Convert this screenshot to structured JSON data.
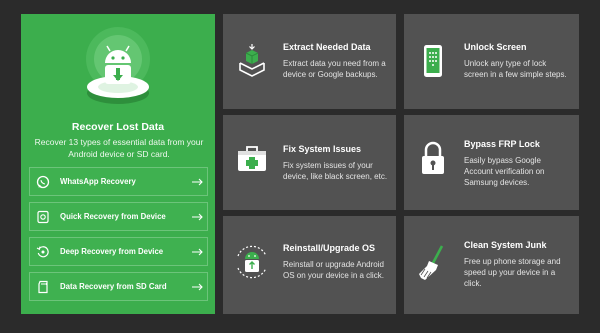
{
  "left": {
    "title": "Recover Lost Data",
    "desc": "Recover 13 types of essential data from your Android device or SD card.",
    "options": [
      {
        "label": "WhatsApp Recovery",
        "icon": "whatsapp-icon"
      },
      {
        "label": "Quick Recovery from Device",
        "icon": "phone-recovery-icon"
      },
      {
        "label": "Deep Recovery from Device",
        "icon": "deep-scan-icon"
      },
      {
        "label": "Data Recovery from SD Card",
        "icon": "sd-card-icon"
      }
    ]
  },
  "cards": {
    "extract": {
      "title": "Extract Needed Data",
      "desc": "Extract data you need from a device or Google backups.",
      "icon": "extract-box-icon"
    },
    "unlock": {
      "title": "Unlock Screen",
      "desc": "Unlock any type of lock screen in a few simple steps.",
      "icon": "unlock-screen-icon"
    },
    "fix": {
      "title": "Fix System Issues",
      "desc": "Fix system issues of your device, like black screen, etc.",
      "icon": "toolkit-icon"
    },
    "frp": {
      "title": "Bypass FRP Lock",
      "desc": "Easily bypass Google Account verification on Samsung devices.",
      "icon": "padlock-icon"
    },
    "reinstall": {
      "title": "Reinstall/Upgrade OS",
      "desc": "Reinstall or upgrade Android OS on your device in a click.",
      "icon": "android-upgrade-icon"
    },
    "clean": {
      "title": "Clean System Junk",
      "desc": "Free up phone storage and speed up your device in a click.",
      "icon": "broom-icon"
    }
  },
  "colors": {
    "accent": "#3cae4d",
    "card": "#525252",
    "background": "#2b2b2b"
  }
}
